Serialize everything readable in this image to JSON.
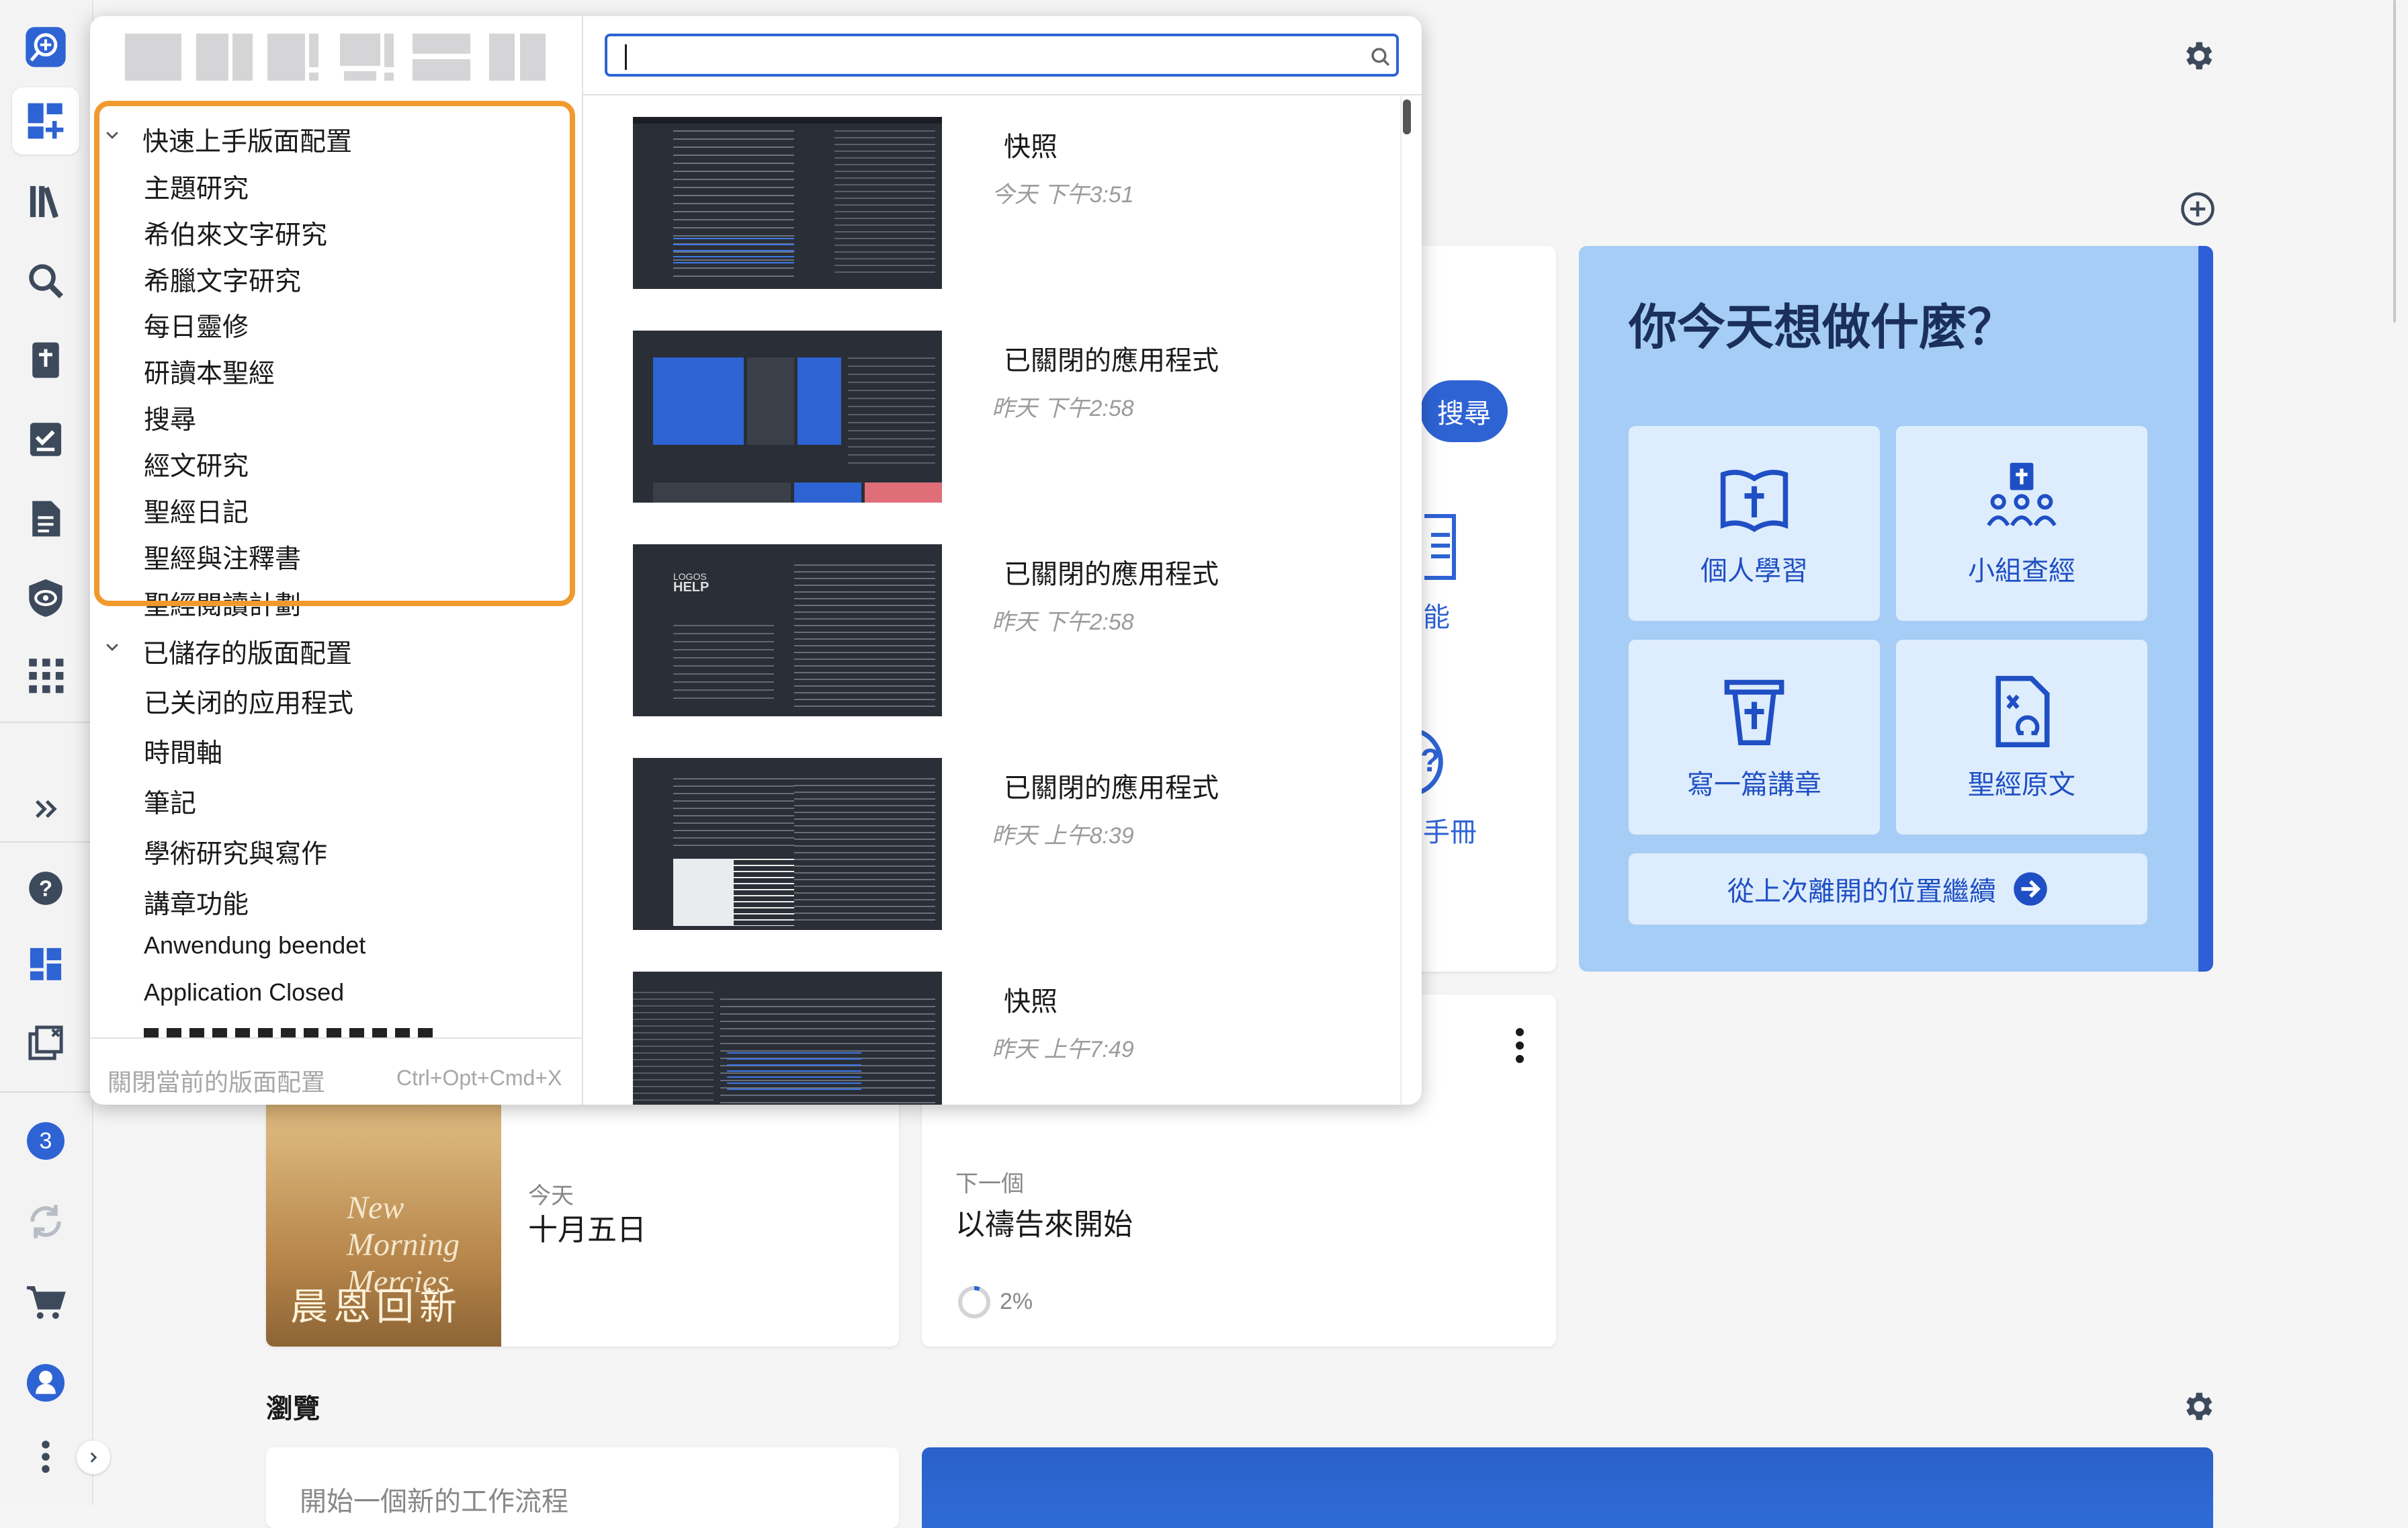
{
  "rail": {
    "badge_count": "3",
    "items": [
      "search-ai-icon",
      "layouts-icon",
      "library-icon",
      "search-icon",
      "bible-icon",
      "checklist-icon",
      "document-icon",
      "guides-icon",
      "apps-grid-icon",
      "expand-icon",
      "help-icon",
      "dashboard-icon",
      "closed-apps-icon",
      "badge",
      "sync-icon",
      "cart-icon",
      "profile-icon",
      "more-icon"
    ]
  },
  "popup": {
    "search": {
      "value": "",
      "placeholder": ""
    },
    "groups": [
      {
        "label": "快速上手版面配置",
        "items": [
          "主題研究",
          "希伯來文字研究",
          "希臘文字研究",
          "每日靈修",
          "研讀本聖經",
          "搜尋",
          "經文研究",
          "聖經日記",
          "聖經與注釋書",
          "聖經閱讀計劃"
        ]
      },
      {
        "label": "已儲存的版面配置",
        "items": [
          "已关闭的应用程式",
          "時間軸",
          "筆記",
          "學術研究與寫作",
          "講章功能",
          "Anwendung beendet",
          "Application Closed"
        ]
      }
    ],
    "footer": {
      "label": "關閉當前的版面配置",
      "shortcut": "Ctrl+Opt+Cmd+X"
    },
    "snapshots": [
      {
        "title": "快照",
        "time": "今天 下午3:51"
      },
      {
        "title": "已關閉的應用程式",
        "time": "昨天 下午2:58"
      },
      {
        "title": "已關閉的應用程式",
        "time": "昨天 下午2:58"
      },
      {
        "title": "已關閉的應用程式",
        "time": "昨天 上午8:39"
      },
      {
        "title": "快照",
        "time": "昨天 上午7:49"
      }
    ]
  },
  "dashboard": {
    "search_button": "搜尋",
    "partial_tile_1": "能",
    "partial_tile_2": "手冊",
    "what_today": {
      "title": "你今天想做什麼？",
      "tiles": [
        "個人學習",
        "小組查經",
        "寫一篇講章",
        "聖經原文"
      ],
      "resume": "從上次離開的位置繼續"
    },
    "devotion": {
      "date_label": "今天",
      "date": "十月五日",
      "cover_title": "New Morning Mercies",
      "cover_cn": "晨恩回新"
    },
    "plan": {
      "next_label": "下一個",
      "next_title": "以禱告來開始",
      "progress": "2%",
      "progress_value": 0.02
    },
    "browse": {
      "title": "瀏覽",
      "start_workflow": "開始一個新的工作流程"
    }
  },
  "colors": {
    "accent": "#2e63d4",
    "highlight": "#f09a2e",
    "what_today_bg": "#a5cdf5"
  }
}
